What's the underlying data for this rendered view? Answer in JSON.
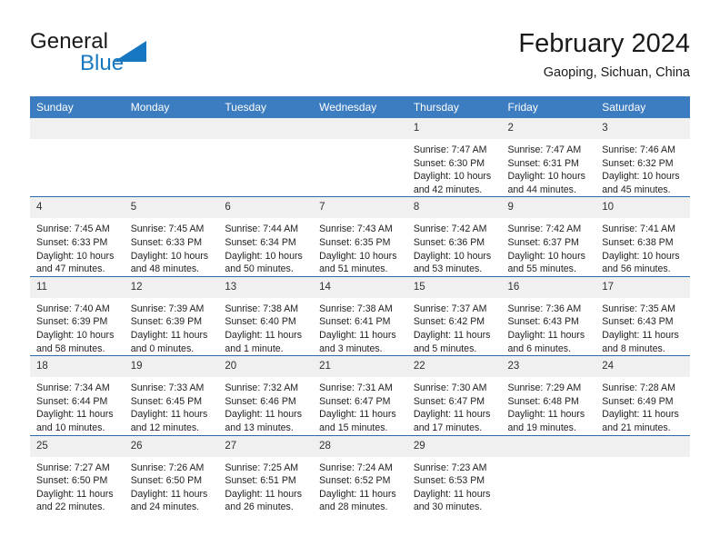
{
  "brand": {
    "name_part1": "General",
    "name_part2": "Blue",
    "triangle_color": "#1778c1"
  },
  "header": {
    "title": "February 2024",
    "subtitle": "Gaoping, Sichuan, China"
  },
  "theme": {
    "header_blue": "#3c7cc0",
    "row_divider_blue": "#2d6aab",
    "daynum_bg": "#f0f0f0",
    "text": "#222222"
  },
  "weekdays": [
    "Sunday",
    "Monday",
    "Tuesday",
    "Wednesday",
    "Thursday",
    "Friday",
    "Saturday"
  ],
  "labels": {
    "sunrise": "Sunrise:",
    "sunset": "Sunset:",
    "daylight": "Daylight:"
  },
  "weeks": [
    [
      {
        "day": ""
      },
      {
        "day": ""
      },
      {
        "day": ""
      },
      {
        "day": ""
      },
      {
        "day": "1",
        "sunrise": "Sunrise: 7:47 AM",
        "sunset": "Sunset: 6:30 PM",
        "daylight": "Daylight: 10 hours and 42 minutes."
      },
      {
        "day": "2",
        "sunrise": "Sunrise: 7:47 AM",
        "sunset": "Sunset: 6:31 PM",
        "daylight": "Daylight: 10 hours and 44 minutes."
      },
      {
        "day": "3",
        "sunrise": "Sunrise: 7:46 AM",
        "sunset": "Sunset: 6:32 PM",
        "daylight": "Daylight: 10 hours and 45 minutes."
      }
    ],
    [
      {
        "day": "4",
        "sunrise": "Sunrise: 7:45 AM",
        "sunset": "Sunset: 6:33 PM",
        "daylight": "Daylight: 10 hours and 47 minutes."
      },
      {
        "day": "5",
        "sunrise": "Sunrise: 7:45 AM",
        "sunset": "Sunset: 6:33 PM",
        "daylight": "Daylight: 10 hours and 48 minutes."
      },
      {
        "day": "6",
        "sunrise": "Sunrise: 7:44 AM",
        "sunset": "Sunset: 6:34 PM",
        "daylight": "Daylight: 10 hours and 50 minutes."
      },
      {
        "day": "7",
        "sunrise": "Sunrise: 7:43 AM",
        "sunset": "Sunset: 6:35 PM",
        "daylight": "Daylight: 10 hours and 51 minutes."
      },
      {
        "day": "8",
        "sunrise": "Sunrise: 7:42 AM",
        "sunset": "Sunset: 6:36 PM",
        "daylight": "Daylight: 10 hours and 53 minutes."
      },
      {
        "day": "9",
        "sunrise": "Sunrise: 7:42 AM",
        "sunset": "Sunset: 6:37 PM",
        "daylight": "Daylight: 10 hours and 55 minutes."
      },
      {
        "day": "10",
        "sunrise": "Sunrise: 7:41 AM",
        "sunset": "Sunset: 6:38 PM",
        "daylight": "Daylight: 10 hours and 56 minutes."
      }
    ],
    [
      {
        "day": "11",
        "sunrise": "Sunrise: 7:40 AM",
        "sunset": "Sunset: 6:39 PM",
        "daylight": "Daylight: 10 hours and 58 minutes."
      },
      {
        "day": "12",
        "sunrise": "Sunrise: 7:39 AM",
        "sunset": "Sunset: 6:39 PM",
        "daylight": "Daylight: 11 hours and 0 minutes."
      },
      {
        "day": "13",
        "sunrise": "Sunrise: 7:38 AM",
        "sunset": "Sunset: 6:40 PM",
        "daylight": "Daylight: 11 hours and 1 minute."
      },
      {
        "day": "14",
        "sunrise": "Sunrise: 7:38 AM",
        "sunset": "Sunset: 6:41 PM",
        "daylight": "Daylight: 11 hours and 3 minutes."
      },
      {
        "day": "15",
        "sunrise": "Sunrise: 7:37 AM",
        "sunset": "Sunset: 6:42 PM",
        "daylight": "Daylight: 11 hours and 5 minutes."
      },
      {
        "day": "16",
        "sunrise": "Sunrise: 7:36 AM",
        "sunset": "Sunset: 6:43 PM",
        "daylight": "Daylight: 11 hours and 6 minutes."
      },
      {
        "day": "17",
        "sunrise": "Sunrise: 7:35 AM",
        "sunset": "Sunset: 6:43 PM",
        "daylight": "Daylight: 11 hours and 8 minutes."
      }
    ],
    [
      {
        "day": "18",
        "sunrise": "Sunrise: 7:34 AM",
        "sunset": "Sunset: 6:44 PM",
        "daylight": "Daylight: 11 hours and 10 minutes."
      },
      {
        "day": "19",
        "sunrise": "Sunrise: 7:33 AM",
        "sunset": "Sunset: 6:45 PM",
        "daylight": "Daylight: 11 hours and 12 minutes."
      },
      {
        "day": "20",
        "sunrise": "Sunrise: 7:32 AM",
        "sunset": "Sunset: 6:46 PM",
        "daylight": "Daylight: 11 hours and 13 minutes."
      },
      {
        "day": "21",
        "sunrise": "Sunrise: 7:31 AM",
        "sunset": "Sunset: 6:47 PM",
        "daylight": "Daylight: 11 hours and 15 minutes."
      },
      {
        "day": "22",
        "sunrise": "Sunrise: 7:30 AM",
        "sunset": "Sunset: 6:47 PM",
        "daylight": "Daylight: 11 hours and 17 minutes."
      },
      {
        "day": "23",
        "sunrise": "Sunrise: 7:29 AM",
        "sunset": "Sunset: 6:48 PM",
        "daylight": "Daylight: 11 hours and 19 minutes."
      },
      {
        "day": "24",
        "sunrise": "Sunrise: 7:28 AM",
        "sunset": "Sunset: 6:49 PM",
        "daylight": "Daylight: 11 hours and 21 minutes."
      }
    ],
    [
      {
        "day": "25",
        "sunrise": "Sunrise: 7:27 AM",
        "sunset": "Sunset: 6:50 PM",
        "daylight": "Daylight: 11 hours and 22 minutes."
      },
      {
        "day": "26",
        "sunrise": "Sunrise: 7:26 AM",
        "sunset": "Sunset: 6:50 PM",
        "daylight": "Daylight: 11 hours and 24 minutes."
      },
      {
        "day": "27",
        "sunrise": "Sunrise: 7:25 AM",
        "sunset": "Sunset: 6:51 PM",
        "daylight": "Daylight: 11 hours and 26 minutes."
      },
      {
        "day": "28",
        "sunrise": "Sunrise: 7:24 AM",
        "sunset": "Sunset: 6:52 PM",
        "daylight": "Daylight: 11 hours and 28 minutes."
      },
      {
        "day": "29",
        "sunrise": "Sunrise: 7:23 AM",
        "sunset": "Sunset: 6:53 PM",
        "daylight": "Daylight: 11 hours and 30 minutes."
      },
      {
        "day": ""
      },
      {
        "day": ""
      }
    ]
  ]
}
